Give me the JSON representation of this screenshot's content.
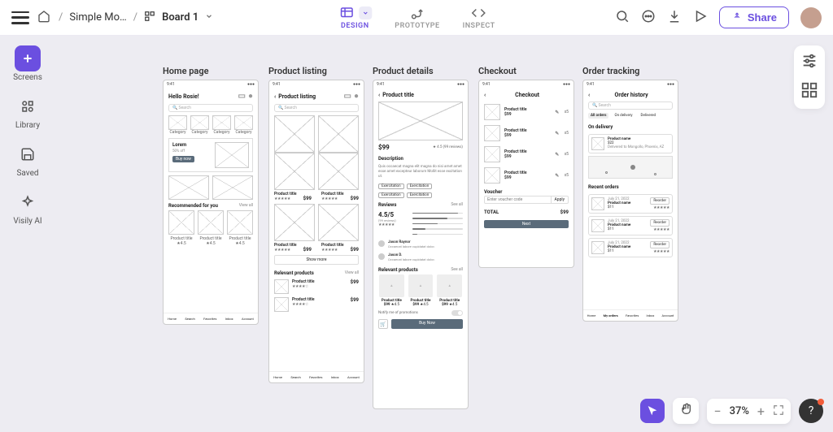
{
  "breadcrumb": {
    "project": "Simple Mo…",
    "board": "Board 1"
  },
  "top_nav": {
    "design": "DESIGN",
    "prototype": "PROTOTYPE",
    "inspect": "INSPECT"
  },
  "share_label": "Share",
  "left_rail": {
    "screens": "Screens",
    "library": "Library",
    "saved": "Saved",
    "ai": "Visily AI"
  },
  "zoom": {
    "value": "37%"
  },
  "labels": {
    "home": "Home page",
    "listing": "Product listing",
    "details": "Product details",
    "checkout": "Checkout",
    "tracking": "Order tracking"
  },
  "time": "9:41",
  "home": {
    "greeting": "Hello Rosie!",
    "search": "Search",
    "category": "Category",
    "lorem": "Lorem",
    "discount": "50% off",
    "buy": "Buy now",
    "rec_title": "Recommended for you",
    "view_all": "View all",
    "prod": "Product title",
    "rating": "★4.5",
    "nav": [
      "Home",
      "Search",
      "Favorites",
      "Inbox",
      "Account"
    ]
  },
  "listing": {
    "title": "Product listing",
    "prod": "Product title",
    "price": "$99",
    "see_all": "See all",
    "show_more": "Show more",
    "relevant": "Relevant products"
  },
  "details": {
    "title": "Product title",
    "price": "$99",
    "rating": "4.5",
    "reviews_count": "(99 reviews)",
    "desc_label": "Description",
    "desc": "Quis occaecat magna elit magna do nisi amet amet esse amet excepteur laborum Mollit esse excitation ut.",
    "exerc": "Exercitation",
    "reviews_label": "Reviews",
    "score": "4.5/5",
    "reviewer1": "Jason Raynor",
    "reviewer2": "Jason D.",
    "review_line": "Occaecat labore cupidatat dolor.",
    "relevant": "Relevant products",
    "notify": "Notify me of promotions",
    "buy": "Buy Now"
  },
  "checkout": {
    "title": "Checkout",
    "prod": "Product title",
    "price": "$99",
    "qty": "x5",
    "voucher_label": "Voucher",
    "voucher_ph": "Enter voucher code",
    "apply": "Apply",
    "total": "TOTAL",
    "total_val": "$99",
    "next": "Next"
  },
  "tracking": {
    "title": "Order history",
    "search": "Search",
    "tab_all": "All orders",
    "tab_delivery": "On delivery",
    "tab_delivered": "Delivered",
    "on_delivery": "On delivery",
    "prod": "Product name",
    "price": "$22",
    "deliv": "Delivered to Mongollo, Phoenix, AZ",
    "recent": "Recent orders",
    "date": "July 21, 2022",
    "prod2": "Product name",
    "p2": "$11",
    "reorder": "Reorder",
    "nav": [
      "Home",
      "My orders",
      "Favorites",
      "Inbox",
      "Account"
    ]
  }
}
